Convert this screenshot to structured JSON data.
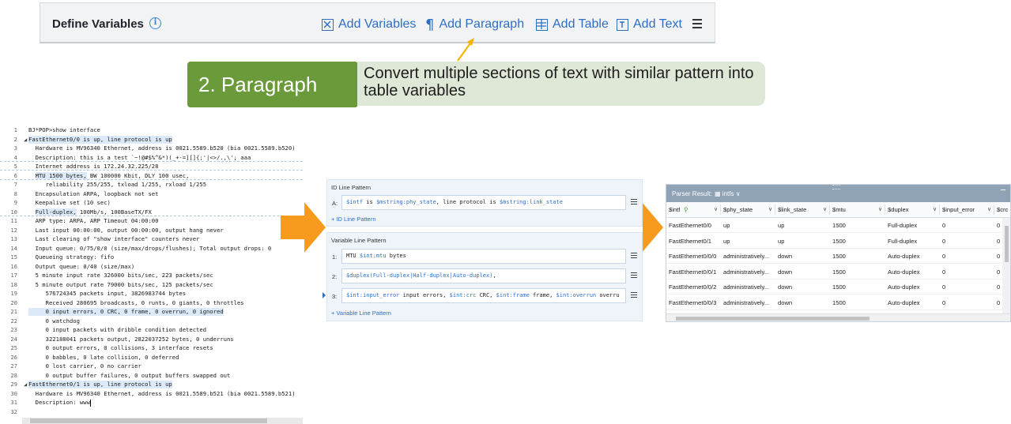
{
  "toolbar": {
    "title": "Define Variables",
    "info_icon": "i",
    "add_variables": "Add Variables",
    "add_paragraph": "Add Paragraph",
    "add_table": "Add Table",
    "add_text": "Add Text",
    "paragraph_glyph": "¶"
  },
  "callout": {
    "label": "2. Paragraph",
    "description": "Convert multiple sections of text with similar pattern into table variables",
    "arrow_color": "#f5b400",
    "label_color": "#6b9a3b"
  },
  "code": {
    "lines": [
      {
        "n": "1",
        "t": "BJ*POP>show interface"
      },
      {
        "n": "2",
        "t": "FastEthernet0/0 is up, line protocol is up",
        "fold": true,
        "hl": true
      },
      {
        "n": "3",
        "t": "  Hardware is MV96340 Ethernet, address is 0021.5589.b520 (bia 0021.5589.b520)"
      },
      {
        "n": "4",
        "t": "  Description: this is a test `~!@#$%^&*)(_+-=][]{;'|<>/.,\\'; aaa"
      },
      {
        "n": "5",
        "t": "  Internet address is 172.24.32.225/28"
      },
      {
        "n": "6",
        "t": "  MTU 1500 bytes, BW 100000 Kbit, DLY 100 usec,",
        "hl2": "MTU 1500 bytes,"
      },
      {
        "n": "7",
        "t": "     reliability 255/255, txload 1/255, rxload 1/255"
      },
      {
        "n": "8",
        "t": "  Encapsulation ARPA, loopback not set"
      },
      {
        "n": "9",
        "t": "  Keepalive set (10 sec)"
      },
      {
        "n": "10",
        "t": "  Full-duplex, 100Mb/s, 100BaseTX/FX",
        "hl2": "Full-duplex,"
      },
      {
        "n": "11",
        "t": "  ARP type: ARPA, ARP Timeout 04:00:00"
      },
      {
        "n": "12",
        "t": "  Last input 00:00:00, output 00:00:00, output hang never"
      },
      {
        "n": "13",
        "t": "  Last clearing of \"show interface\" counters never"
      },
      {
        "n": "14",
        "t": "  Input queue: 0/75/0/0 (size/max/drops/flushes); Total output drops: 0"
      },
      {
        "n": "15",
        "t": "  Queueing strategy: fifo"
      },
      {
        "n": "16",
        "t": "  Output queue: 0/40 (size/max)"
      },
      {
        "n": "17",
        "t": "  5 minute input rate 326000 bits/sec, 223 packets/sec"
      },
      {
        "n": "18",
        "t": "  5 minute output rate 79000 bits/sec, 125 packets/sec"
      },
      {
        "n": "19",
        "t": "     576724345 packets input, 3826983744 bytes"
      },
      {
        "n": "20",
        "t": "     Received 280695 broadcasts, 0 runts, 0 giants, 0 throttles"
      },
      {
        "n": "21",
        "t": "     0 input errors, 0 CRC, 0 frame, 0 overrun, 0 ignored",
        "hl": true
      },
      {
        "n": "22",
        "t": "     0 watchdog"
      },
      {
        "n": "23",
        "t": "     0 input packets with dribble condition detected"
      },
      {
        "n": "24",
        "t": "     322188041 packets output, 2822037252 bytes, 0 underruns"
      },
      {
        "n": "25",
        "t": "     0 output errors, 0 collisions, 3 interface resets"
      },
      {
        "n": "26",
        "t": "     0 babbles, 0 late collision, 0 deferred"
      },
      {
        "n": "27",
        "t": "     0 lost carrier, 0 no carrier"
      },
      {
        "n": "28",
        "t": "     0 output buffer failures, 0 output buffers swapped out"
      },
      {
        "n": "29",
        "t": "FastEthernet0/1 is up, line protocol is up",
        "fold": true,
        "hl": true
      },
      {
        "n": "30",
        "t": "  Hardware is MV96340 Ethernet, address is 0021.5589.b521 (bia 0021.5589.b521)"
      },
      {
        "n": "31",
        "t": "  Description: www",
        "cursor": true
      },
      {
        "n": "32",
        "t": ""
      }
    ]
  },
  "patterns": {
    "id_title": "ID Line Pattern",
    "id_rows": [
      {
        "label": "A:",
        "parts": [
          [
            "v",
            "$intf"
          ],
          [
            "t",
            " is "
          ],
          [
            "v",
            "$mstring:phy_state"
          ],
          [
            "t",
            ", line protocol is "
          ],
          [
            "v",
            "$mstring:link_state"
          ]
        ]
      }
    ],
    "add_id": "+ ID Line Pattern",
    "var_title": "Variable Line Pattern",
    "var_rows": [
      {
        "label": "1:",
        "parts": [
          [
            "t",
            "MTU "
          ],
          [
            "v",
            "$int:mtu"
          ],
          [
            "t",
            " bytes"
          ]
        ]
      },
      {
        "label": "2:",
        "parts": [
          [
            "v",
            "$duplex(Full-duplex|Half-duplex|Auto-duplex)"
          ],
          [
            "t",
            ","
          ]
        ]
      },
      {
        "label": "3:",
        "parts": [
          [
            "v",
            "$int:input_error"
          ],
          [
            "t",
            " input errors, "
          ],
          [
            "v",
            "$int:crc"
          ],
          [
            "t",
            " CRC, "
          ],
          [
            "v",
            "$int:frame"
          ],
          [
            "t",
            " frame, "
          ],
          [
            "v",
            "$int:overrun"
          ],
          [
            "t",
            " overru"
          ]
        ]
      }
    ],
    "add_var": "+ Variable Line Pattern"
  },
  "results": {
    "header": "Parser Result:",
    "table_name": "intfs",
    "columns": [
      "$intf",
      "$phy_state",
      "$link_state",
      "$mtu",
      "$duplex",
      "$input_error",
      "$crc"
    ],
    "rows": [
      [
        "FastEthernet0/0",
        "up",
        "up",
        "1500",
        "Full-duplex",
        "0",
        "0"
      ],
      [
        "FastEthernet0/1",
        "up",
        "up",
        "1500",
        "Full-duplex",
        "0",
        "0"
      ],
      [
        "FastEthernet0/0/0",
        "administratively...",
        "down",
        "1500",
        "Auto-duplex",
        "0",
        "0"
      ],
      [
        "FastEthernet0/0/1",
        "administratively...",
        "down",
        "1500",
        "Auto-duplex",
        "0",
        "0"
      ],
      [
        "FastEthernet0/0/2",
        "administratively...",
        "down",
        "1500",
        "Auto-duplex",
        "0",
        "0"
      ],
      [
        "FastEthernet0/0/3",
        "administratively...",
        "down",
        "1500",
        "Auto-duplex",
        "0",
        "0"
      ]
    ]
  },
  "colors": {
    "accent": "#2e6fc4",
    "orange": "#f79a1e"
  }
}
